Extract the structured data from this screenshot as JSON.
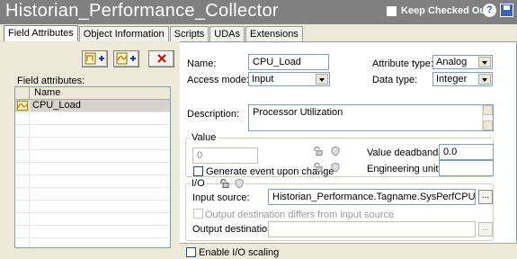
{
  "window": {
    "title": "Historian_Performance_Collector",
    "keep_checked_out_label": "Keep Checked Out",
    "help_icon": "?"
  },
  "tabs": [
    {
      "label": "Field Attributes",
      "active": true
    },
    {
      "label": "Object Information",
      "active": false
    },
    {
      "label": "Scripts",
      "active": false
    },
    {
      "label": "UDAs",
      "active": false
    },
    {
      "label": "Extensions",
      "active": false
    }
  ],
  "left": {
    "toolbar_icons": [
      "add-attribute-icon",
      "add-analog-attribute-icon",
      "delete-icon"
    ],
    "field_attributes_label": "Field attributes:",
    "grid": {
      "column_header": "Name",
      "rows": [
        {
          "name": "CPU_Load",
          "icon": "analog-attribute-icon",
          "selected": true
        }
      ]
    }
  },
  "form": {
    "name_label": "Name:",
    "name_value": "CPU_Load",
    "access_mode_label": "Access mode:",
    "access_mode_value": "Input",
    "attribute_type_label": "Attribute type:",
    "attribute_type_value": "Analog",
    "data_type_label": "Data type:",
    "data_type_value": "Integer",
    "description_label": "Description:",
    "description_value": "Processor Utilization"
  },
  "value_group": {
    "title": "Value",
    "value_field": "0",
    "generate_event_label": "Generate event upon change",
    "value_deadband_label": "Value deadband:",
    "value_deadband_value": "0.0",
    "engineering_units_label": "Engineering units:",
    "engineering_units_value": ""
  },
  "io_group": {
    "title": "I/O",
    "input_source_label": "Input source:",
    "input_source_value": "Historian_Performance.Tagname.SysPerfCPUTotal",
    "output_differs_label": "Output destination differs from input source",
    "output_destination_label": "Output destination:",
    "output_destination_value": "",
    "ellipsis": "..."
  },
  "enable_io_scaling_label": "Enable I/O scaling",
  "colors": {
    "titlebar": "#808080",
    "face": "#ece9d8",
    "field_border": "#7f9db9"
  }
}
